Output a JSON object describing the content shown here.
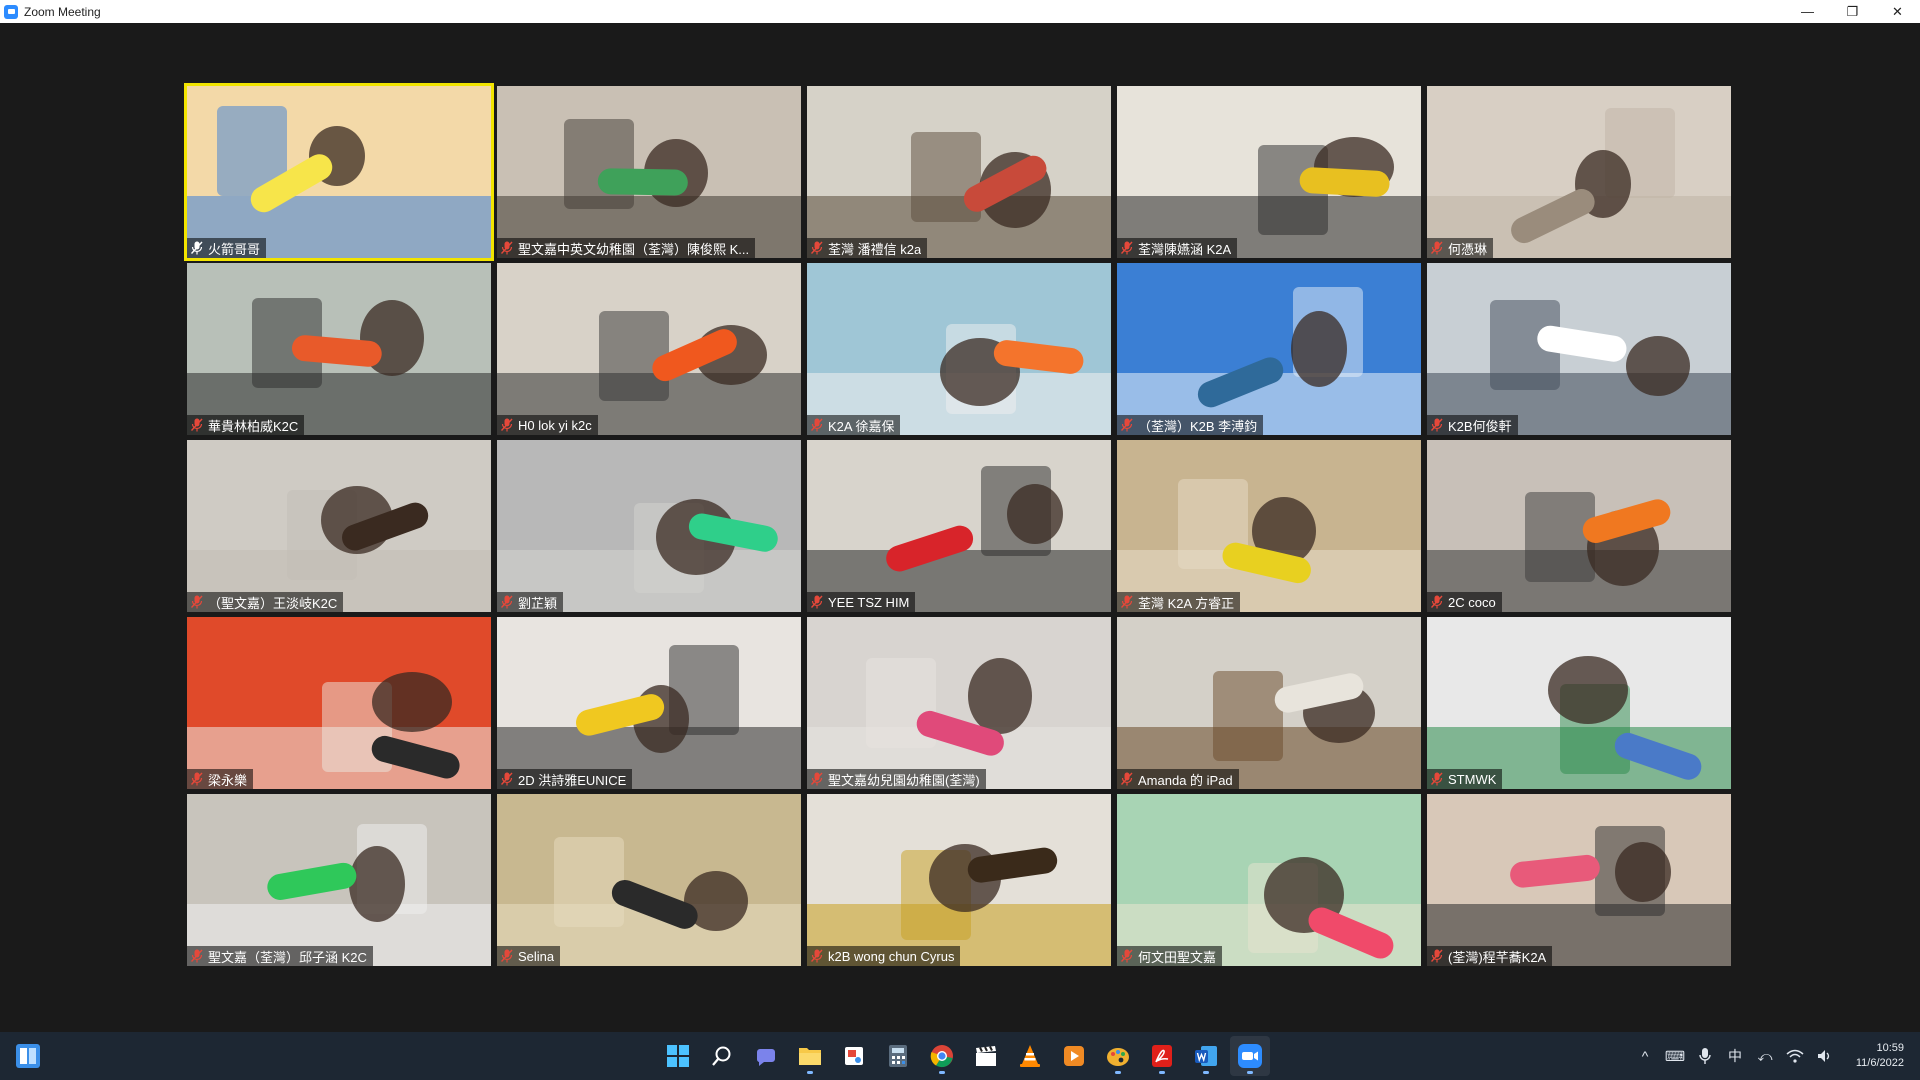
{
  "window": {
    "title": "Zoom Meeting"
  },
  "window_controls": {
    "minimize": "—",
    "restore": "❐",
    "close": "✕"
  },
  "tiles": [
    {
      "name": "火箭哥哥",
      "scene": [
        "#f3d9a8",
        "#3c7fd8",
        "#f7e54a"
      ],
      "active": true
    },
    {
      "name": "聖文嘉中英文幼稚園（荃灣）陳俊熙 K...",
      "scene": [
        "#c9c0b4",
        "#3f3a33",
        "#3fa15a"
      ]
    },
    {
      "name": "荃灣 潘禮信 k2a",
      "scene": [
        "#d6d2c8",
        "#5a4a3a",
        "#c84a3a"
      ]
    },
    {
      "name": "荃灣陳嬿涵 K2A",
      "scene": [
        "#e7e3da",
        "#2a2a2a",
        "#e8c020"
      ]
    },
    {
      "name": "何憑琳",
      "scene": [
        "#d8cfc4",
        "#bfb4a6",
        "#9a8c7c"
      ]
    },
    {
      "name": "華貴林柏威K2C",
      "scene": [
        "#b8c0b8",
        "#2c2c2c",
        "#e85a2a"
      ]
    },
    {
      "name": "H0 lok yi k2c",
      "scene": [
        "#d8d2c8",
        "#333333",
        "#f0581e"
      ]
    },
    {
      "name": "K2A 徐嘉保",
      "scene": [
        "#9fc6d6",
        "#f0f0f0",
        "#f4742c"
      ]
    },
    {
      "name": "（荃灣）K2B 李溥鈞",
      "scene": [
        "#3b7fd4",
        "#e8f0f8",
        "#2f6a9a"
      ]
    },
    {
      "name": "K2B何俊軒",
      "scene": [
        "#c8cfd4",
        "#3f4a58",
        "#ffffff"
      ]
    },
    {
      "name": "（聖文嘉）王淡岐K2C",
      "scene": [
        "#cfcbc4",
        "#c2bdb5",
        "#3a2a20"
      ]
    },
    {
      "name": "劉芷穎",
      "scene": [
        "#b8b8b8",
        "#d4d4d0",
        "#2fcf8a"
      ]
    },
    {
      "name": "YEE TSZ HIM",
      "scene": [
        "#d8d4cc",
        "#2a2a2a",
        "#d8242a"
      ]
    },
    {
      "name": "荃灣 K2A 方睿正",
      "scene": [
        "#c8b490",
        "#e8dcc8",
        "#e8d020"
      ]
    },
    {
      "name": "2C coco",
      "scene": [
        "#c8c0b8",
        "#3a3a3a",
        "#f07820"
      ]
    },
    {
      "name": "梁永樂",
      "scene": [
        "#e04a2a",
        "#ece8e0",
        "#2a2a2a"
      ]
    },
    {
      "name": "2D 洪詩雅EUNICE",
      "scene": [
        "#e8e4e0",
        "#2c2c2c",
        "#f0c820"
      ]
    },
    {
      "name": "聖文嘉幼兒園幼稚園(荃灣)",
      "scene": [
        "#d8d4d0",
        "#e8e4e0",
        "#e04a7a"
      ]
    },
    {
      "name": "Amanda 的 iPad",
      "scene": [
        "#d4d0c8",
        "#6a4a2a",
        "#e8e4dc"
      ]
    },
    {
      "name": "STMWK",
      "scene": [
        "#e8e8e8",
        "#2a8a4a",
        "#4a7ac8"
      ]
    },
    {
      "name": "聖文嘉（荃灣）邱子涵 K2C",
      "scene": [
        "#c8c4bc",
        "#f0f0f0",
        "#2fc85a"
      ]
    },
    {
      "name": "Selina",
      "scene": [
        "#c8b890",
        "#e8dcc0",
        "#2a2a2a"
      ]
    },
    {
      "name": "k2B wong chun Cyrus",
      "scene": [
        "#e4e0d8",
        "#c8a020",
        "#3a2a1a"
      ]
    },
    {
      "name": "何文田聖文嘉",
      "scene": [
        "#a8d4b4",
        "#e8e4d0",
        "#f04a6a"
      ]
    },
    {
      "name": "(荃灣)程芊蕎K2A",
      "scene": [
        "#d8c8b8",
        "#2a2a2a",
        "#e85a7a"
      ]
    }
  ],
  "taskbar": {
    "apps": [
      {
        "name": "start-icon"
      },
      {
        "name": "search-icon"
      },
      {
        "name": "teams-chat-icon"
      },
      {
        "name": "file-explorer-icon"
      },
      {
        "name": "snipping-tool-icon"
      },
      {
        "name": "calculator-icon"
      },
      {
        "name": "chrome-icon"
      },
      {
        "name": "clapperboard-icon"
      },
      {
        "name": "vlc-icon"
      },
      {
        "name": "media-player-icon"
      },
      {
        "name": "paint-icon"
      },
      {
        "name": "acrobat-icon"
      },
      {
        "name": "word-icon"
      },
      {
        "name": "zoom-icon"
      }
    ],
    "tray": {
      "chevron": "^",
      "keyboard": "⌨",
      "mic": "🎤",
      "ime": "中",
      "ime_mode": "⤺",
      "wifi": "wifi",
      "volume": "🔊"
    },
    "clock": {
      "time": "10:59",
      "date": "11/6/2022"
    }
  }
}
